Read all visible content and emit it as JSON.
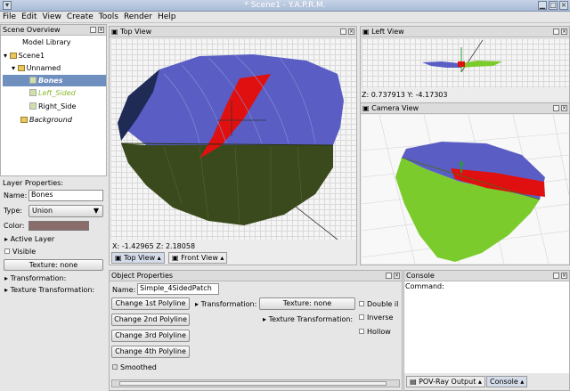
{
  "window": {
    "title": "* Scene1 - Y.A.P.R.M."
  },
  "menu": [
    "File",
    "Edit",
    "View",
    "Create",
    "Tools",
    "Render",
    "Help"
  ],
  "scene_overview": {
    "title": "Scene Overview",
    "items": [
      "Model Library",
      "Scene1",
      "Unnamed",
      "Bones",
      "Left_Sided",
      "Right_Side",
      "Background"
    ]
  },
  "layer_properties": {
    "title": "Layer Properties:",
    "name_label": "Name:",
    "name_value": "Bones",
    "type_label": "Type:",
    "type_value": "Union",
    "color_label": "Color:",
    "color_value": "#8a6d6b",
    "active_layer": "Active Layer",
    "visible": "Visible",
    "texture_button": "Texture: none",
    "transformation": "Transformation:",
    "texture_transformation": "Texture Transformation:"
  },
  "top_view": {
    "title": "Top View",
    "coords": "X: -1.42965 Z: 2.18058",
    "tabs": [
      "Top View",
      "Front View"
    ]
  },
  "left_view": {
    "title": "Left View",
    "coords": "Z: 0.737913 Y: -4.17303"
  },
  "camera_view": {
    "title": "Camera View"
  },
  "object_properties": {
    "title": "Object Properties",
    "name_label": "Name:",
    "name_value": "Simple_4SidedPatch",
    "buttons": [
      "Change 1st Polyline",
      "Change 2nd Polyline",
      "Change 3rd Polyline",
      "Change 4th Polyline"
    ],
    "smoothed": "Smoothed",
    "transformation": "Transformation:",
    "texture_button": "Texture: none",
    "texture_transformation": "Texture Transformation:",
    "double_illuminate": "Double il",
    "inverse": "Inverse",
    "hollow": "Hollow"
  },
  "console": {
    "title": "Console",
    "command_label": "Command:",
    "tabs": [
      "POV-Ray Output",
      "Console"
    ]
  },
  "colors": {
    "leaf_blue": "#5a5ec4",
    "leaf_dark": "#3a4a1c",
    "bone_red": "#e01010",
    "green": "#7ccb2c"
  }
}
